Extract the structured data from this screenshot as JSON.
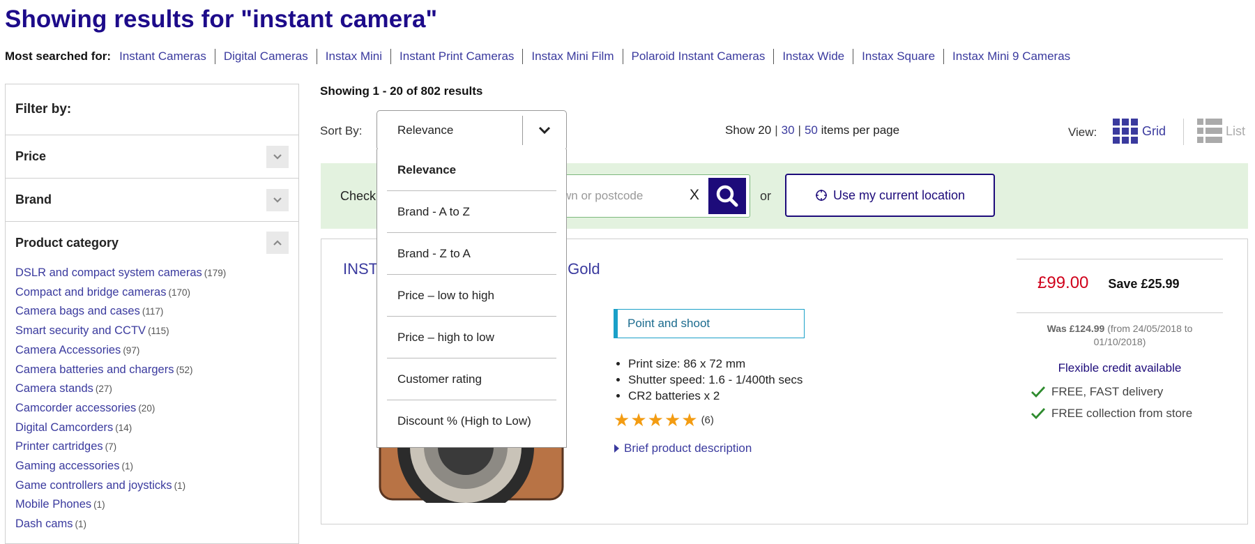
{
  "header": {
    "title": "Showing results for \"instant camera\"",
    "most_searched_label": "Most searched for:",
    "most_searched": [
      "Instant Cameras",
      "Digital Cameras",
      "Instax Mini",
      "Instant Print Cameras",
      "Instax Mini Film",
      "Polaroid Instant Cameras",
      "Instax Wide",
      "Instax Square",
      "Instax Mini 9 Cameras"
    ]
  },
  "sidebar": {
    "filter_by": "Filter by:",
    "facets": {
      "price": "Price",
      "brand": "Brand",
      "category": "Product category"
    },
    "categories": [
      {
        "name": "DSLR and compact system cameras",
        "count": "(179)"
      },
      {
        "name": "Compact and bridge cameras",
        "count": "(170)"
      },
      {
        "name": "Camera bags and cases",
        "count": "(117)"
      },
      {
        "name": "Smart security and CCTV",
        "count": "(115)"
      },
      {
        "name": "Camera Accessories",
        "count": "(97)"
      },
      {
        "name": "Camera batteries and chargers",
        "count": "(52)"
      },
      {
        "name": "Camera stands",
        "count": "(27)"
      },
      {
        "name": "Camcorder accessories",
        "count": "(20)"
      },
      {
        "name": "Digital Camcorders",
        "count": "(14)"
      },
      {
        "name": "Printer cartridges",
        "count": "(7)"
      },
      {
        "name": "Gaming accessories",
        "count": "(1)"
      },
      {
        "name": "Game controllers and joysticks",
        "count": "(1)"
      },
      {
        "name": "Mobile Phones",
        "count": "(1)"
      },
      {
        "name": "Dash cams",
        "count": "(1)"
      }
    ]
  },
  "toolbar": {
    "results": "Showing 1 - 20 of 802 results",
    "sort_label": "Sort By:",
    "sort_value": "Relevance",
    "per_page": {
      "show": "Show",
      "current": "20",
      "opt_30": "30",
      "opt_50": "50",
      "suffix": "items per page"
    },
    "view_label": "View:",
    "grid": "Grid",
    "list": "List"
  },
  "sort_options": [
    "Relevance",
    "Brand - A to Z",
    "Brand - Z to A",
    "Price – low to high",
    "Price – high to low",
    "Customer rating",
    "Discount % (High to Low)"
  ],
  "store": {
    "check_label": "Check",
    "placeholder": "er town or postcode",
    "clear": "X",
    "or": "or",
    "use_location": "Use my current location"
  },
  "product": {
    "title_start": "INST",
    "title_end": "Gold",
    "tag": "Point and shoot",
    "specs": [
      "Print size: 86 x 72 mm",
      "Shutter speed: 1.6 - 1/400th secs",
      "CR2 batteries x 2"
    ],
    "rating_stars": 5,
    "rating_count": "(6)",
    "brief": "Brief product description",
    "price": "£99.00",
    "save": "Save £25.99",
    "was_label": "Was £124.99",
    "was_dates": "(from 24/05/2018 to 01/10/2018)",
    "credit": "Flexible credit available",
    "delivery": "FREE, FAST delivery",
    "collection": "FREE collection from store"
  },
  "colors": {
    "brand": "#1d0b8a",
    "link": "#3a3a9e",
    "price": "#d0021b",
    "check": "#2e8b2e",
    "star": "#f39c12"
  }
}
